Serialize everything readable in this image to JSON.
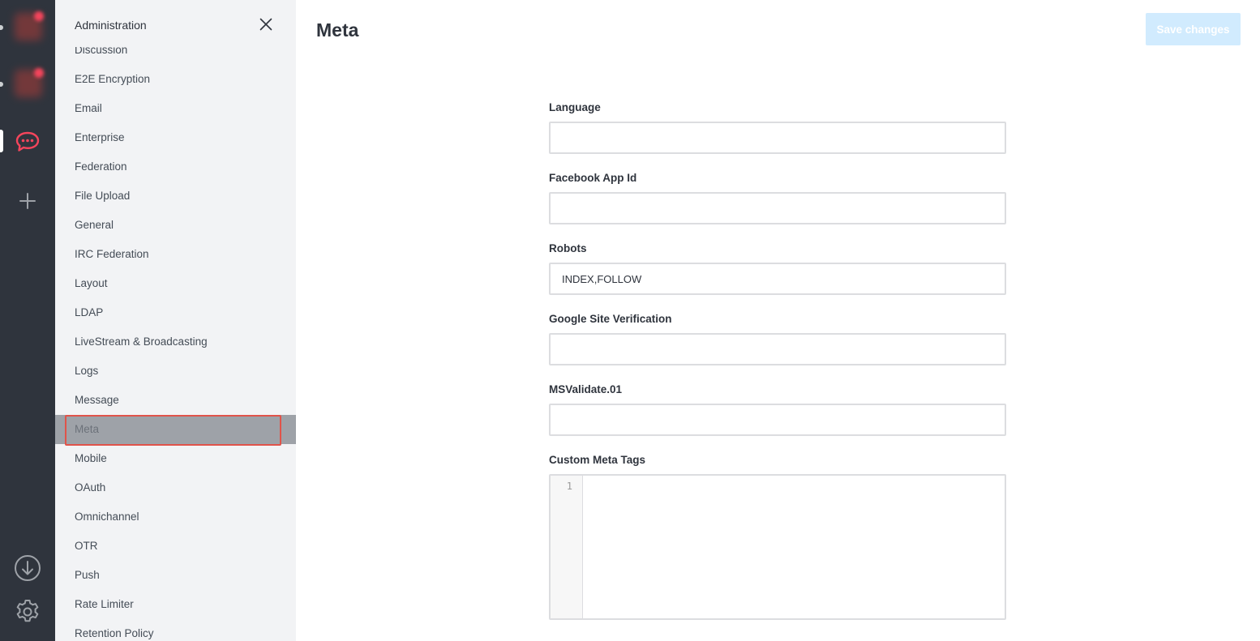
{
  "sidebar": {
    "title": "Administration",
    "items": [
      {
        "label": "Discussion"
      },
      {
        "label": "E2E Encryption"
      },
      {
        "label": "Email"
      },
      {
        "label": "Enterprise"
      },
      {
        "label": "Federation"
      },
      {
        "label": "File Upload"
      },
      {
        "label": "General"
      },
      {
        "label": "IRC Federation"
      },
      {
        "label": "Layout"
      },
      {
        "label": "LDAP"
      },
      {
        "label": "LiveStream & Broadcasting"
      },
      {
        "label": "Logs"
      },
      {
        "label": "Message"
      },
      {
        "label": "Meta",
        "active": true
      },
      {
        "label": "Mobile"
      },
      {
        "label": "OAuth"
      },
      {
        "label": "Omnichannel"
      },
      {
        "label": "OTR"
      },
      {
        "label": "Push"
      },
      {
        "label": "Rate Limiter"
      },
      {
        "label": "Retention Policy"
      }
    ]
  },
  "main": {
    "title": "Meta",
    "save_label": "Save changes",
    "fields": [
      {
        "label": "Language",
        "value": ""
      },
      {
        "label": "Facebook App Id",
        "value": ""
      },
      {
        "label": "Robots",
        "value": "INDEX,FOLLOW"
      },
      {
        "label": "Google Site Verification",
        "value": ""
      },
      {
        "label": "MSValidate.01",
        "value": ""
      }
    ],
    "custom_meta": {
      "label": "Custom Meta Tags",
      "line_number": "1"
    }
  },
  "colors": {
    "rail_bg": "#2f343d",
    "sidebar_bg": "#f2f3f5",
    "accent_red": "#f5455c",
    "save_disabled": "#d1ebfe",
    "highlight_border": "#e0534a"
  },
  "icons": {
    "rail": [
      "server-avatar-icon",
      "server-avatar-icon",
      "rocketchat-logo-icon",
      "add-icon",
      "download-icon",
      "gear-icon"
    ],
    "sidebar": [
      "close-icon"
    ]
  }
}
